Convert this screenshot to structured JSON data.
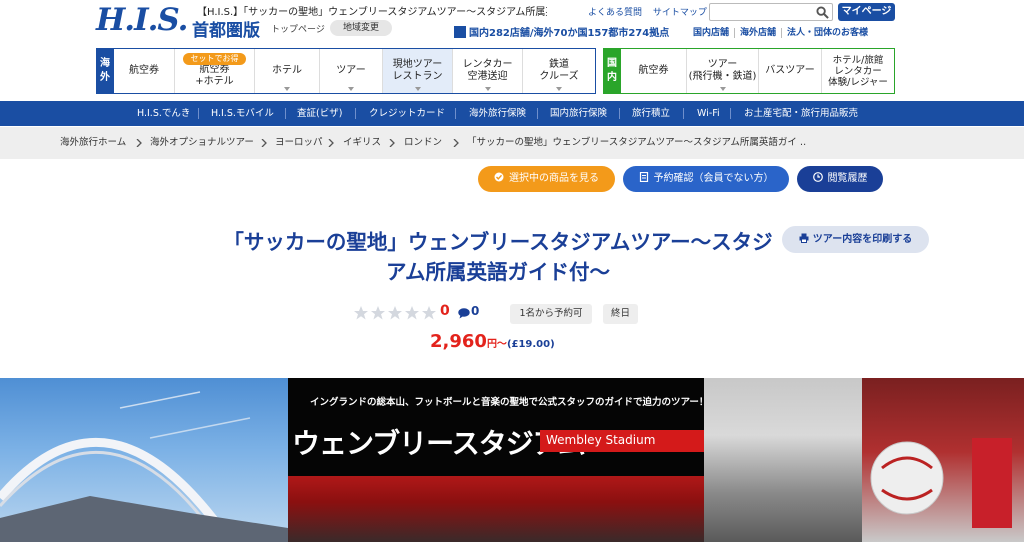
{
  "header": {
    "logo": "H.I.S.",
    "page_title": "【H.I.S.】「サッカーの聖地」ウェンブリースタジアムツアー〜スタジアム所属英 …",
    "region": "首都圏版",
    "top_link": "トップページ",
    "region_change": "地域変更",
    "stores": "国内282店舗/海外70か国157都市274拠点",
    "faq": "よくある質問",
    "sitemap": "サイトマップ",
    "search_placeholder": "",
    "mypage": "マイページ",
    "store_links": [
      "国内店舗",
      "海外店舗",
      "法人・団体のお客様"
    ]
  },
  "overseas_nav": {
    "label": "海外",
    "set_badge": "セットでお得",
    "items": [
      "航空券",
      "航空券\n+ホテル",
      "ホテル",
      "ツアー",
      "現地ツアー\nレストラン",
      "レンタカー\n空港送迎",
      "鉄道\nクルーズ"
    ]
  },
  "domestic_nav": {
    "label": "国内",
    "items": [
      "航空券",
      "ツアー\n(飛行機・鉄道)",
      "バスツアー",
      "ホテル/旅館\nレンタカー\n体験/レジャー"
    ]
  },
  "service_nav": [
    "H.I.S.でんき",
    "H.I.S.モバイル",
    "査証(ビザ)",
    "クレジットカード",
    "海外旅行保険",
    "国内旅行保険",
    "旅行積立",
    "Wi-Fi",
    "お土産宅配・旅行用品販売"
  ],
  "breadcrumb": [
    "海外旅行ホーム",
    "海外オプショナルツアー",
    "ヨーロッパ",
    "イギリス",
    "ロンドン",
    "「サッカーの聖地」ウェンブリースタジアムツアー〜スタジアム所属英語ガイ …"
  ],
  "actions": {
    "selected_items": "選択中の商品を見る",
    "booking_check": "予約確認（会員でない方）",
    "history": "閲覧履歴"
  },
  "tour": {
    "title": "「サッカーの聖地」ウェンブリースタジアムツアー〜スタジアム所属英語ガイド付〜",
    "print": "ツアー内容を印刷する",
    "rating": 0,
    "rating_text": "0",
    "reviews_text": "0",
    "tags": [
      "1名から予約可",
      "終日"
    ],
    "price": "2,960",
    "price_suffix": "円〜",
    "price_gbp": "(£19.00)"
  },
  "hero": {
    "caption": "イングランドの総本山、フットボールと音楽の聖地で公式スタッフのガイドで迫力のツアー！",
    "title_ja": "ウェンブリースタジアム",
    "title_en": "Wembley Stadium"
  },
  "colors": {
    "brand_blue": "#1a4ea3",
    "domestic_green": "#2aa52a",
    "orange": "#f39a1a",
    "price_red": "#e3231c"
  }
}
